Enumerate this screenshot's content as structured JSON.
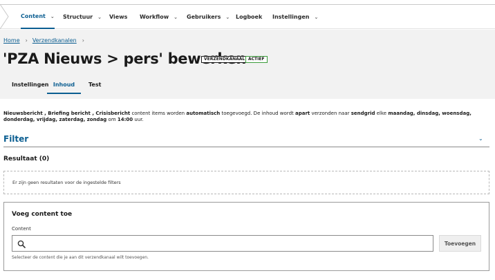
{
  "nav": {
    "items": [
      {
        "label": "Content",
        "has_dropdown": true,
        "active": true
      },
      {
        "label": "Structuur",
        "has_dropdown": true
      },
      {
        "label": "Views",
        "has_dropdown": false
      },
      {
        "label": "Workflow",
        "has_dropdown": true
      },
      {
        "label": "Gebruikers",
        "has_dropdown": true
      },
      {
        "label": "Logboek",
        "has_dropdown": false
      },
      {
        "label": "Instellingen",
        "has_dropdown": true
      }
    ]
  },
  "breadcrumb": {
    "home": "Home",
    "section": "Verzendkanalen"
  },
  "page": {
    "title": "'PZA Nieuws > pers' bewerken",
    "badge_type": "VERZENDKANAAL",
    "badge_status": "ACTIEF"
  },
  "tabs": [
    {
      "label": "Instellingen"
    },
    {
      "label": "Inhoud",
      "active": true
    },
    {
      "label": "Test"
    }
  ],
  "description": {
    "types": "Nieuwsbericht , Briefing bericht , Crisisbericht",
    "t1": " content items worden ",
    "mode": "automatisch",
    "t2": " toegevoegd. De inhoud wordt ",
    "send_mode": "apart",
    "t3": " verzonden naar ",
    "target": "sendgrid",
    "t4": " elke ",
    "days": "maandag, dinsdag, woensdag, donderdag, vrijdag, zaterdag, zondag",
    "t5": " om ",
    "time": "14:00",
    "t6": " uur."
  },
  "filter": {
    "title": "Filter"
  },
  "results": {
    "title": "Resultaat (0)",
    "empty_message": "Er zijn geen resultaten voor de ingestelde filters"
  },
  "add_content": {
    "title": "Voeg content toe",
    "field_label": "Content",
    "field_value": "",
    "button_label": "Toevoegen",
    "help_text": "Selecteer de content die je aan dit verzendkanaal wilt toevoegen."
  },
  "colors": {
    "accent": "#0b5e91",
    "status_green": "#3a9b3a",
    "header_bg": "#f2f2f2"
  }
}
